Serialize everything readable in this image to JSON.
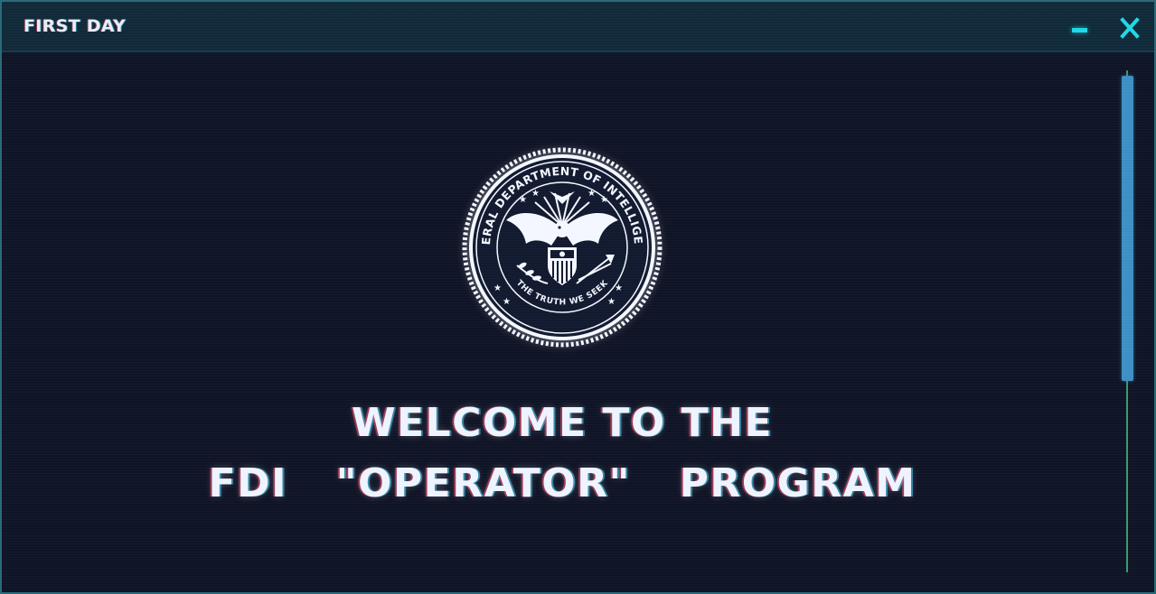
{
  "window": {
    "title": "FIRST DAY",
    "minimize_icon": "minimize-icon",
    "close_icon": "close-icon",
    "accent_color": "#1fd8e6",
    "background_color": "#0f1426"
  },
  "seal": {
    "name": "fdi-seal",
    "outer_text": "FEDERAL DEPARTMENT OF INTELLIGENCE",
    "motto": "THE TRUTH WE SEEK"
  },
  "welcome": {
    "line1": "WELCOME TO THE",
    "line2": "FDI  \"OPERATOR\"  PROGRAM"
  },
  "scrollbar": {
    "thumb_color": "#3d8fc4",
    "track_color": "#3a9a6a"
  }
}
